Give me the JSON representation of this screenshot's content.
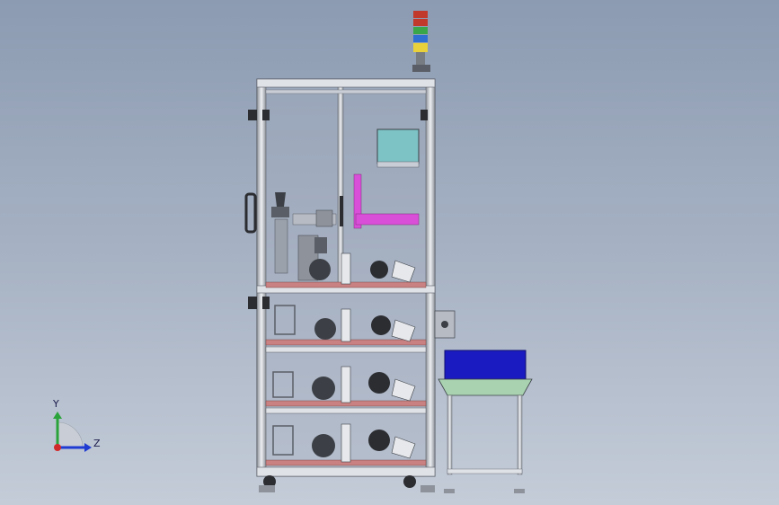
{
  "viewport": {
    "axes": {
      "y_label": "Y",
      "z_label": "Z"
    },
    "colors": {
      "frame": "#d7dbe1",
      "frame_dark": "#5a5e66",
      "monitor": "#7dc3c6",
      "gantry": "#d94fd8",
      "plate": "#c98181",
      "bin": "#1b1bc2",
      "bin_base": "#a8d2b0",
      "light_red": "#c0392b",
      "light_green": "#3aa64a",
      "light_blue": "#2f6fd1",
      "light_yellow": "#e8d13a"
    },
    "icons": [
      "signal-tower-icon",
      "triad-icon"
    ]
  }
}
